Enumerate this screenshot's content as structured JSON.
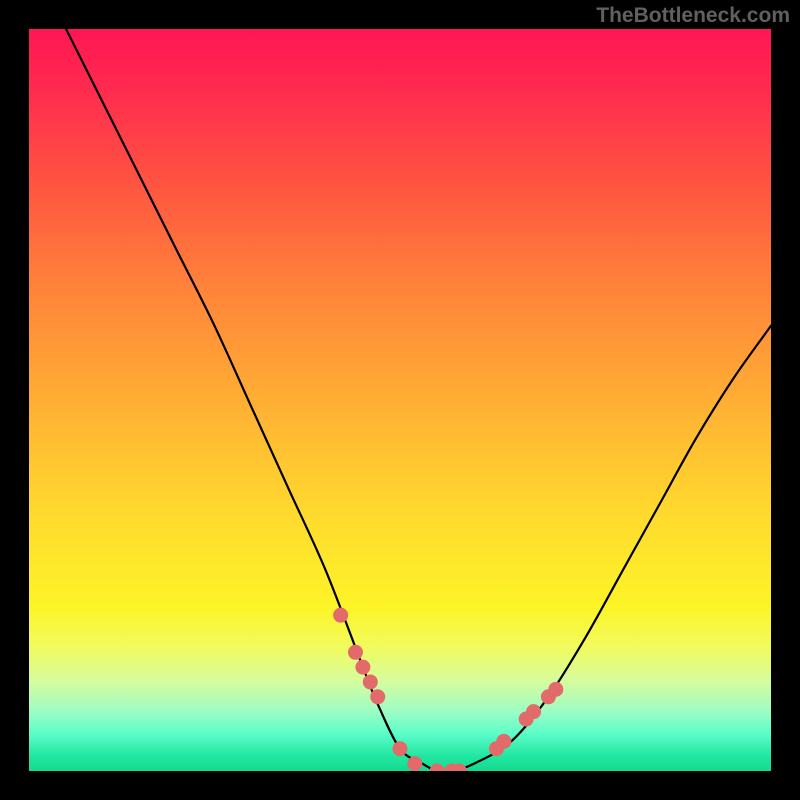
{
  "watermark": "TheBottleneck.com",
  "chart_data": {
    "type": "line",
    "title": "",
    "xlabel": "",
    "ylabel": "",
    "xlim": [
      0,
      100
    ],
    "ylim": [
      0,
      100
    ],
    "series": [
      {
        "name": "bottleneck-curve",
        "x": [
          5,
          10,
          15,
          20,
          25,
          30,
          35,
          40,
          45,
          47,
          50,
          53,
          55,
          57,
          60,
          65,
          70,
          75,
          80,
          85,
          90,
          95,
          100
        ],
        "y": [
          100,
          90,
          80,
          70,
          60,
          49,
          38,
          27,
          14,
          9,
          3,
          1,
          0,
          0,
          1,
          4,
          10,
          18,
          27,
          36,
          45,
          53,
          60
        ]
      }
    ],
    "markers": {
      "name": "highlight-dots",
      "color": "#e36a6a",
      "x": [
        42,
        44,
        45,
        46,
        47,
        50,
        52,
        55,
        57,
        58,
        63,
        64,
        67,
        68,
        70,
        71
      ],
      "y": [
        21,
        16,
        14,
        12,
        10,
        3,
        1,
        0,
        0,
        0,
        3,
        4,
        7,
        8,
        10,
        11
      ]
    },
    "gradient_stops": [
      {
        "pos": 0,
        "color": "#ff1654"
      },
      {
        "pos": 22,
        "color": "#ff5840"
      },
      {
        "pos": 50,
        "color": "#ffae34"
      },
      {
        "pos": 78,
        "color": "#fdf428"
      },
      {
        "pos": 100,
        "color": "#16d98f"
      }
    ]
  }
}
